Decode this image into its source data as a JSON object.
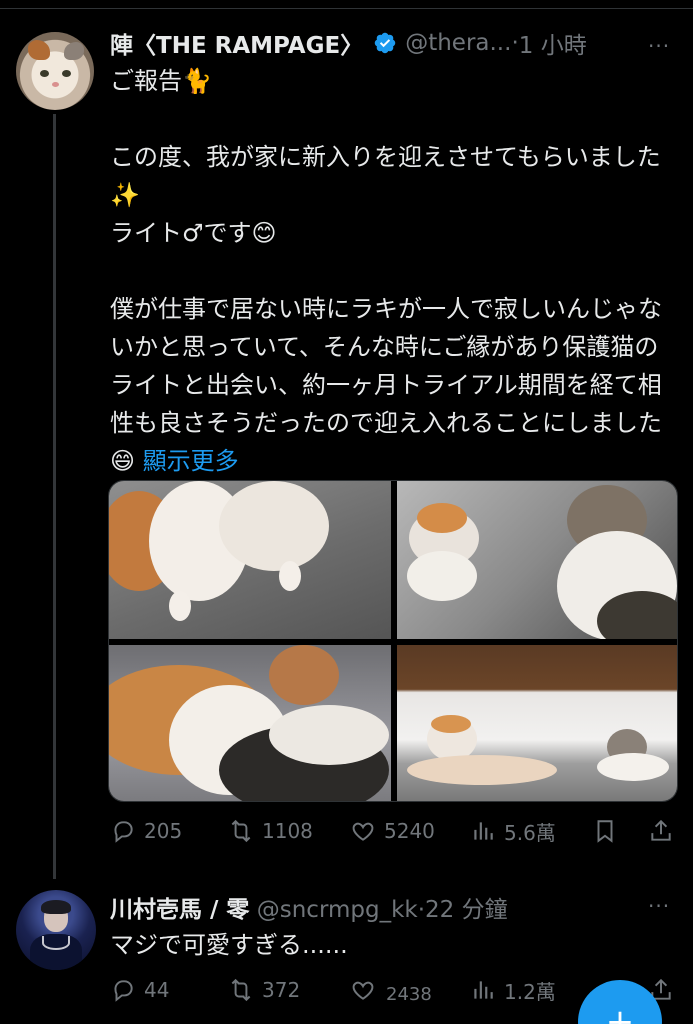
{
  "tweet": {
    "author_name": "陣〈THE RAMPAGE〉",
    "handle": "@thera...",
    "dot": "·",
    "time": "1 小時",
    "more": "···",
    "text": "ご報告🐈\n\nこの度、我が家に新入りを迎えさせてもらいました✨\nライト♂です😊\n\n僕が仕事で居ない時にラキが一人で寂しいんじゃないかと思っていて、そんな時にご縁があり保護猫のライトと出会い、約一ヶ月トライアル期間を経て相性も良さそうだったので迎え入れることにしました😄 ",
    "show_more": "顯示更多",
    "photos": [
      "cat-photo-1",
      "cat-photo-2",
      "cat-photo-3",
      "cat-photo-4"
    ],
    "actions": {
      "replies": "205",
      "reposts": "1108",
      "likes": "5240",
      "views": "5.6萬"
    }
  },
  "reply": {
    "author_name": "川村壱馬 / 零",
    "handle": "@sncrmpg_kk",
    "dot": "·",
    "time": "22 分鐘",
    "more": "···",
    "text": "マジで可愛すぎる......",
    "actions": {
      "replies": "44",
      "reposts": "372",
      "likes_partial": "2438",
      "views": "1.2萬"
    }
  },
  "colors": {
    "background": "#000000",
    "text": "#e7e9ea",
    "muted": "#71767b",
    "accent": "#1d9bf0",
    "divider": "#2f3336"
  },
  "icons": [
    "verified-badge-icon",
    "more-icon",
    "reply-icon",
    "repost-icon",
    "like-icon",
    "views-icon",
    "bookmark-icon",
    "share-icon",
    "compose-icon"
  ]
}
